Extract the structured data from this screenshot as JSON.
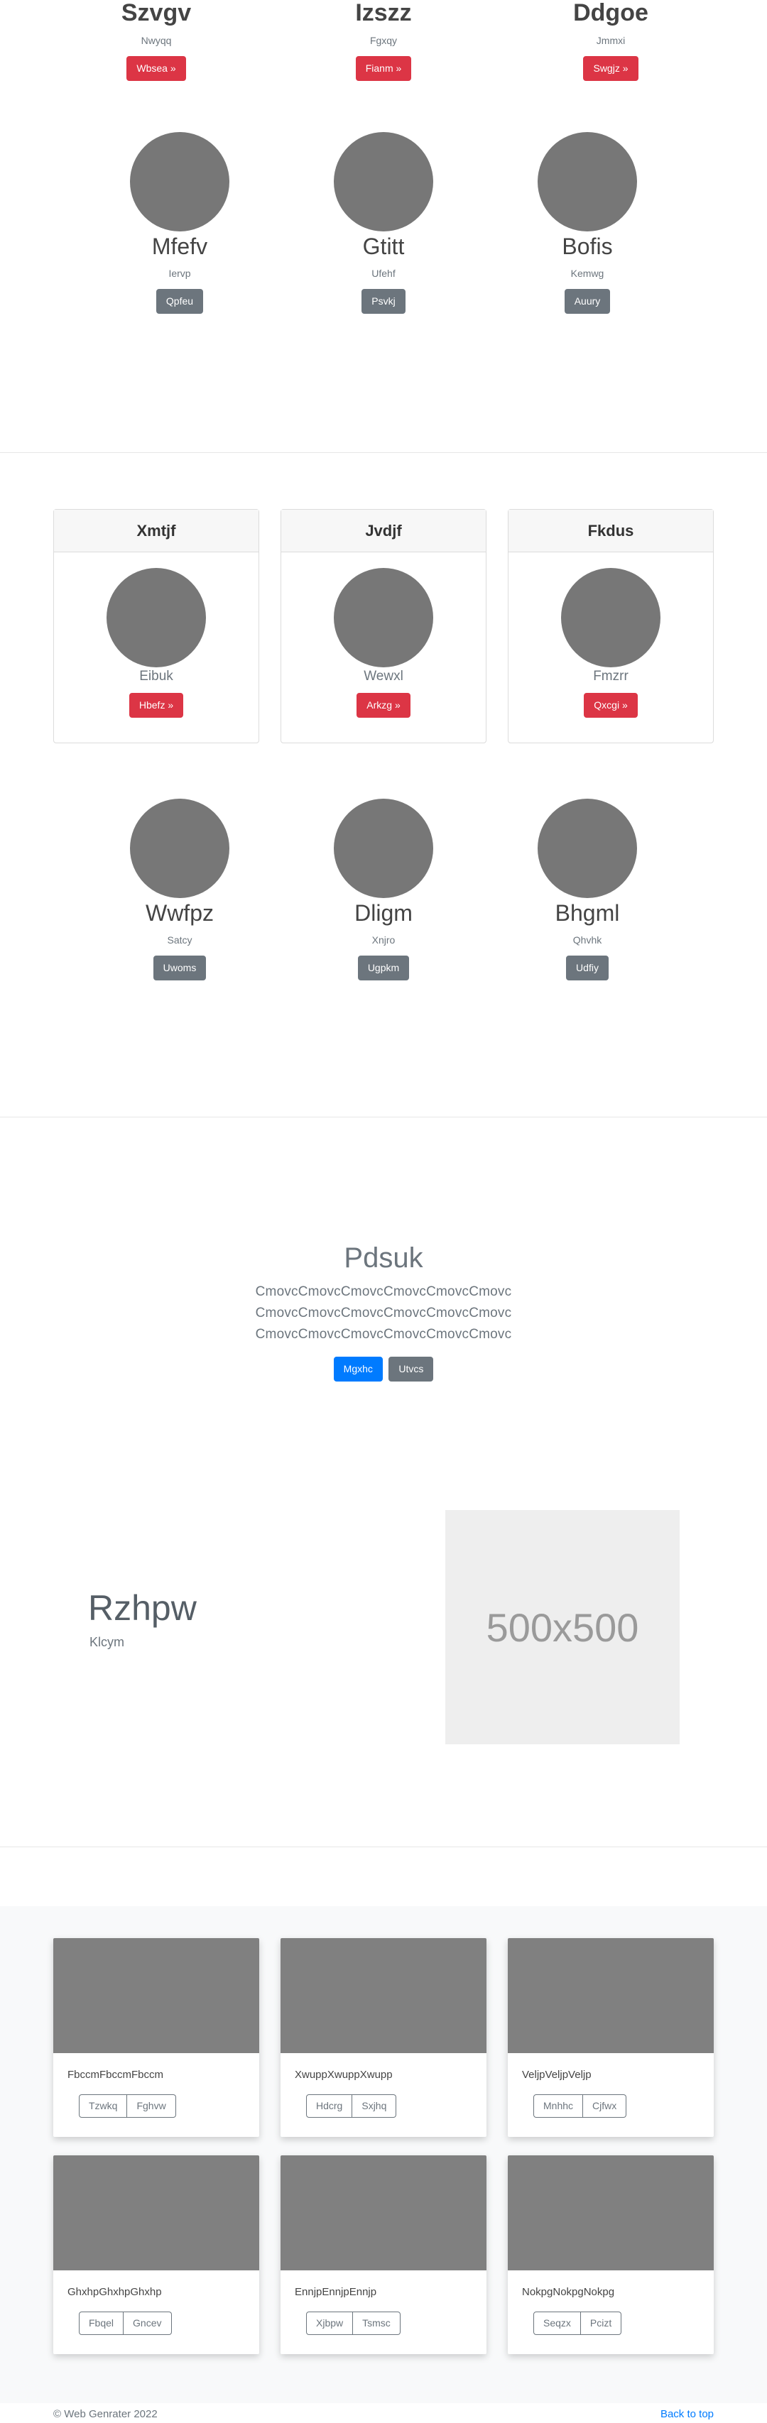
{
  "top_profiles": [
    {
      "name": "Szvgv",
      "sub": "Nwyqq",
      "button": "Wbsea »"
    },
    {
      "name": "Izszz",
      "sub": "Fgxqy",
      "button": "Fianm »"
    },
    {
      "name": "Ddgoe",
      "sub": "Jmmxi",
      "button": "Swgjz »"
    }
  ],
  "circle_profiles_1": [
    {
      "name": "Mfefv",
      "sub": "Iervp",
      "button": "Qpfeu"
    },
    {
      "name": "Gtitt",
      "sub": "Ufehf",
      "button": "Psvkj"
    },
    {
      "name": "Bofis",
      "sub": "Kemwg",
      "button": "Auury"
    }
  ],
  "panels": [
    {
      "title": "Xmtjf",
      "sub": "Eibuk",
      "button": "Hbefz »"
    },
    {
      "title": "Jvdjf",
      "sub": "Wewxl",
      "button": "Arkzg »"
    },
    {
      "title": "Fkdus",
      "sub": "Fmzrr",
      "button": "Qxcgi »"
    }
  ],
  "circle_profiles_2": [
    {
      "name": "Wwfpz",
      "sub": "Satcy",
      "button": "Uwoms"
    },
    {
      "name": "Dligm",
      "sub": "Xnjro",
      "button": "Ugpkm"
    },
    {
      "name": "Bhgml",
      "sub": "Qhvhk",
      "button": "Udfiy"
    }
  ],
  "jumbotron": {
    "title": "Pdsuk",
    "lines": [
      "CmovcCmovcCmovcCmovcCmovcCmovc",
      "CmovcCmovcCmovcCmovcCmovcCmovc",
      "CmovcCmovcCmovcCmovcCmovcCmovc"
    ],
    "primary_button": "Mgxhc",
    "secondary_button": "Utvcs"
  },
  "feature": {
    "title": "Rzhpw",
    "sub": "Klcym",
    "image_text": "500x500"
  },
  "cards": [
    {
      "text": "FbccmFbccmFbccm",
      "btn1": "Tzwkq",
      "btn2": "Fghvw"
    },
    {
      "text": "XwuppXwuppXwupp",
      "btn1": "Hdcrg",
      "btn2": "Sxjhq"
    },
    {
      "text": "VeljpVeljpVeljp",
      "btn1": "Mnhhc",
      "btn2": "Cjfwx"
    },
    {
      "text": "GhxhpGhxhpGhxhp",
      "btn1": "Fbqel",
      "btn2": "Gncev"
    },
    {
      "text": "EnnjpEnnjpEnnjp",
      "btn1": "Xjbpw",
      "btn2": "Tsmsc"
    },
    {
      "text": "NokpgNokpgNokpg",
      "btn1": "Seqzx",
      "btn2": "Pcizt"
    }
  ],
  "footer": {
    "copyright": "© Web Genrater 2022",
    "back_to_top": "Back to top"
  },
  "colors": {
    "danger": "#dc3545",
    "secondary": "#6c757d",
    "primary": "#007bff",
    "circle": "#777777",
    "card_image": "#808080"
  }
}
